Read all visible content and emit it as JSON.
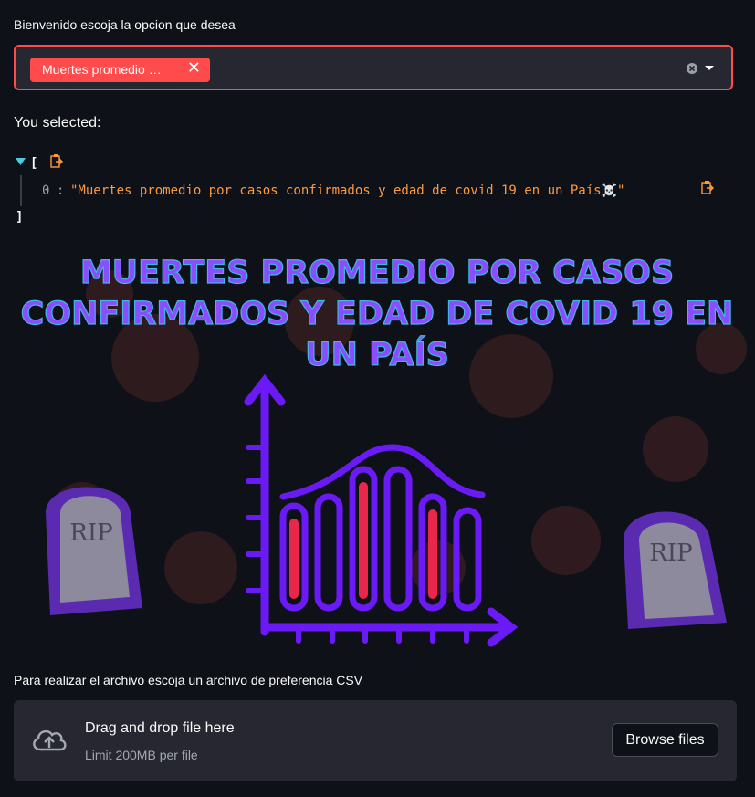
{
  "select": {
    "label": "Bienvenido escoja la opcion que desea",
    "selected_tag": "Muertes promedio …"
  },
  "output": {
    "heading": "You selected:",
    "json_open": "[",
    "json_close": "]",
    "item_index": "0",
    "item_colon": ":",
    "item_value": "\"Muertes promedio por casos confirmados y edad de covid 19 en un País☠️\""
  },
  "banner": {
    "title_lines": [
      "MUERTES PROMEDIO POR CASOS",
      "CONFIRMADOS Y EDAD DE COVID 19 EN",
      "UN PAÍS"
    ],
    "tombstone_text": "RIP"
  },
  "uploader": {
    "label": "Para realizar el archivo escoja un archivo de preferencia CSV",
    "drop_title": "Drag and drop file here",
    "drop_limit": "Limit 200MB per file",
    "browse_label": "Browse files"
  },
  "colors": {
    "accent": "#ff4b4b",
    "background": "#0e1117",
    "widget": "#262730",
    "json_string": "#ff9a3c",
    "banner_purple": "#6a1bf5"
  },
  "icons": {
    "tag_remove": "✕",
    "clear": "clear-icon",
    "caret": "caret-down-icon",
    "collapse": "collapse-triangle-icon",
    "copy": "copy-icon",
    "upload": "cloud-upload-icon"
  }
}
